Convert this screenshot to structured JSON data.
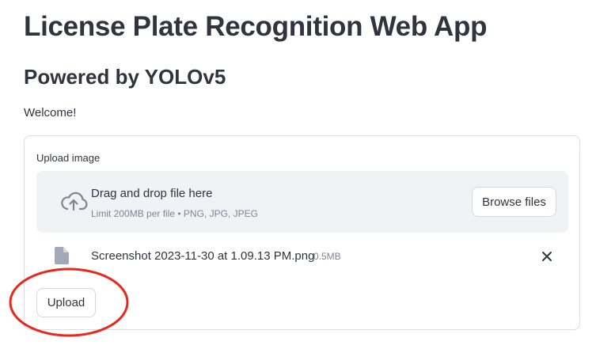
{
  "header": {
    "title": "License Plate Recognition Web App",
    "subtitle": "Powered by YOLOv5",
    "welcome": "Welcome!"
  },
  "uploader": {
    "label": "Upload image",
    "drop_text": "Drag and drop file here",
    "limit_text": "Limit 200MB per file • PNG, JPG, JPEG",
    "browse_label": "Browse files",
    "icon": "cloud-upload-icon"
  },
  "file": {
    "name": "Screenshot 2023-11-30 at 1.09.13 PM.png",
    "size": "0.5MB",
    "icon": "file-icon",
    "remove_icon": "close-icon"
  },
  "actions": {
    "upload_label": "Upload"
  },
  "annotation": {
    "shape": "circle",
    "color": "#e8281c"
  },
  "colors": {
    "text": "#31333f",
    "muted": "#808495",
    "dropzone_bg": "#f0f2f6",
    "border": "#dcdde2"
  }
}
